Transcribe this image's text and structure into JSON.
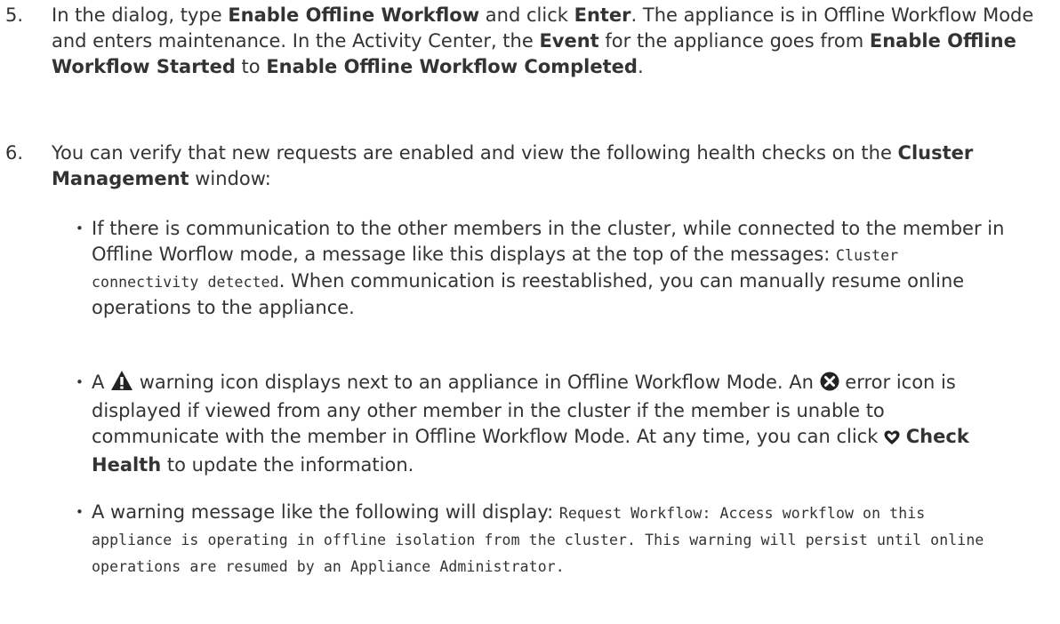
{
  "step5": {
    "number": "5.",
    "t1": "In the dialog, type ",
    "b1": "Enable Offline Workflow",
    "t2": " and click ",
    "b2": "Enter",
    "t3": ". The appliance is in Offline Workflow Mode and enters maintenance. In the Activity Center, the ",
    "b3": "Event",
    "t4": " for the appliance goes from ",
    "b4": "Enable Offline Workflow Started",
    "t5": " to ",
    "b5": "Enable Offline Workflow Completed",
    "t6": "."
  },
  "step6": {
    "number": "6.",
    "t1": "You can verify that new requests are enabled and view the following health checks on the ",
    "b1": "Cluster Management",
    "t2": " window:"
  },
  "bullet1": {
    "t1": "If there is communication to the other members in the cluster, while connected to the member in Offline Worflow mode, a message like this displays at the top of the messages: ",
    "code": "Cluster connectivity detected",
    "t2": ". When communication is reestablished, you can manually resume online operations to the appliance."
  },
  "bullet2": {
    "t1": "A ",
    "t2": " warning icon displays next to an appliance in Offline Workflow Mode. An ",
    "t3": " error icon is displayed if viewed from any other member in the cluster if the member is unable to communicate with the member in Offline Workflow Mode. At any time, you can click ",
    "b1": "Check Health",
    "t4": " to update the information.",
    "icons": [
      "warning-icon",
      "error-icon",
      "heart-icon"
    ]
  },
  "bullet3": {
    "t1": "A warning message like the following will display: ",
    "code": "Request Workflow: Access workflow on this appliance is operating in offline isolation from the cluster. This warning will persist until online operations are resumed by an Appliance Administrator."
  },
  "bullet_glyph": "•",
  "colors": {
    "text": "#333333",
    "icon": "#222222",
    "background": "#ffffff"
  }
}
